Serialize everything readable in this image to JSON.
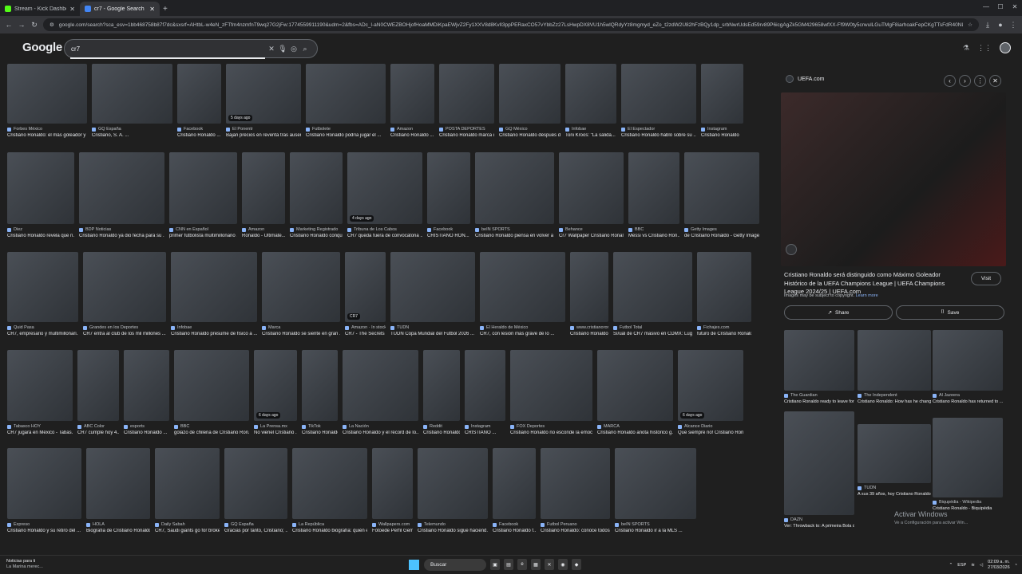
{
  "tabs": [
    {
      "label": "Stream - Kick Dashboard",
      "color": "#53fc18"
    },
    {
      "label": "cr7 - Google Search",
      "color": "#4285f4"
    }
  ],
  "address": {
    "url": "google.com/search?sca_esv=1bb468758b87f7dc&sxsrf=AHtbL-w4eN_zFTfm4nzmfnT9wq27G2jFw:1774559911190&udm=2&fbs=ADc_l-aN0CWEZBOHjofHoaMMDiKpaEWjvZ2Fy1XXV8d8KvlI3ppPERaxCO57vYbbZz27LsHwpDX8VU1h5wlQRdyYz8mgmyd_eZo_t2zdW2U82hFzBQy1dp_srbNwrUdsEd59rv89P6icgAgZk5GM429658wfXX-Ff9W0ty5crwulLGuTMgF8iarhoakFepCKgTTsFdR40NLC8tZ5_LeBVTLbfG80A8cq=cr7&sa=X&ved=2ahUKEwjRrCiGN0L-TAxXpmWoFHXWAGvIQtKgLegQIGBAB&biw=34..."
  },
  "search": {
    "logo": "Google",
    "query": "cr7"
  },
  "row1": [
    {
      "src": "Forbes México",
      "cap": "Cristiano Ronaldo: el más goleador y ..."
    },
    {
      "src": "GQ España",
      "cap": "Cristiano, S. A. ..."
    },
    {
      "src": "Facebook",
      "cap": "Cristiano Ronaldo ..."
    },
    {
      "src": "El Ponentr",
      "cap": "Bajan precios en reventa tras ausenc...",
      "badge": "5 days ago"
    },
    {
      "src": "Futbolete",
      "cap": "Cristiano Ronaldo podría jugar el ..."
    },
    {
      "src": "Amazon",
      "cap": "Cristiano Ronaldo ..."
    },
    {
      "src": "POSTA DEPORTES",
      "cap": "Cristiano Ronaldo marca d..."
    },
    {
      "src": "GQ México",
      "cap": "Cristiano Ronaldo después de Qatar 2..."
    },
    {
      "src": "Infobae",
      "cap": "Toni Kroos: \"La salida..."
    },
    {
      "src": "El Espectador",
      "cap": "Cristiano Ronaldo habló sobre su ..."
    },
    {
      "src": "Instagram",
      "cap": "Cristiano Ronaldo"
    }
  ],
  "row2": [
    {
      "src": "Diez",
      "cap": "Cristiano Ronaldo revela que n..."
    },
    {
      "src": "BDP Noticias",
      "cap": "Cristiano Ronaldo ya dio fecha para su ..."
    },
    {
      "src": "CNN en Español",
      "cap": "primer futbolista multimillonario ..."
    },
    {
      "src": "Amazon",
      "cap": "Ronaldo - Ultimate..."
    },
    {
      "src": "Marketing Registrado",
      "cap": "Cristiano Ronaldo conquista ..."
    },
    {
      "src": "Tribuna de Los Cabos",
      "cap": "CR7 queda fuera de convocatoria ...",
      "badge": "4 days ago"
    },
    {
      "src": "Facebook",
      "cap": "CRISTIANO RON..."
    },
    {
      "src": "beIN SPORTS",
      "cap": "Cristiano Ronaldo piensa en volver a ..."
    },
    {
      "src": "Behance",
      "cap": "Cr7 Wallpaper Cristiano Ronal..."
    },
    {
      "src": "BBC",
      "cap": "Messi vs Cristiano Ron..."
    },
    {
      "src": "Getty Images",
      "cap": "de Cristiano Ronaldo - Getty Image..."
    }
  ],
  "row3": [
    {
      "src": "Quid Pasa",
      "cap": "CR7, empresario y multimillonari..."
    },
    {
      "src": "Grandes en los Deportes",
      "cap": "CR7 entra al club de los mil millones ..."
    },
    {
      "src": "Infobae",
      "cap": "Cristiano Ronaldo presume de físico a ..."
    },
    {
      "src": "Marca",
      "cap": "Cristiano Ronaldo se siente en gran ..."
    },
    {
      "src": "Amazon · In stock",
      "cap": "CR7 - The Secrets ...",
      "badge": "CR7"
    },
    {
      "src": "TUDN",
      "cap": "TUDN Copa Mundial del Futbol 2026 ..."
    },
    {
      "src": "El Heraldo de México",
      "cap": "CR7, con lesión más grave de lo ..."
    },
    {
      "src": "www.cristianoronal...",
      "cap": "Cristiano Ronaldo |..."
    },
    {
      "src": "Futbol Total",
      "cap": "Sí/uál de CR7 masivo en CDMX: Lug..."
    },
    {
      "src": "Fichajes.com",
      "cap": "futuro de Cristiano Ronaldo"
    }
  ],
  "row4": [
    {
      "src": "Tabasco HOY",
      "cap": "CR7 jugará en México - Tabas..."
    },
    {
      "src": "ABC Color",
      "cap": "CR7 cumple hoy 4..."
    },
    {
      "src": "esports",
      "cap": "Cristiano Ronaldo ..."
    },
    {
      "src": "BBC",
      "cap": "golazo de chilena de Cristiano Ron..."
    },
    {
      "src": "La Prensa.mx",
      "cap": "No vienel Cristiano ...",
      "badge": "6 days ago"
    },
    {
      "src": "TikTok",
      "cap": "Cristiano Ronaldo: ..."
    },
    {
      "src": "La Nación",
      "cap": "Cristiano Ronaldo y el récord de lo..."
    },
    {
      "src": "Reddit",
      "cap": "Cristiano Ronaldo ..."
    },
    {
      "src": "Instagram",
      "cap": "CRISTIANO ..."
    },
    {
      "src": "FOX Deportes",
      "cap": "Cristiano Ronaldo no esconde la emoci..."
    },
    {
      "src": "MARCA",
      "cap": "Cristiano Ronaldo anota histórico g..."
    },
    {
      "src": "Alcance Diario",
      "cap": "Que siempre no! Cristiano Ron...",
      "badge": "6 days ago"
    }
  ],
  "row5": [
    {
      "src": "Expreso",
      "cap": "Cristiano Ronaldo y su retiro del ..."
    },
    {
      "src": "HOLA",
      "cap": "Biografía de Cristiano Ronaldo"
    },
    {
      "src": "Daily Sabah",
      "cap": "CR7, Saudi giants go for broke..."
    },
    {
      "src": "GQ España",
      "cap": "Gracias por tanto, Cristiano; ..."
    },
    {
      "src": "La República",
      "cap": "Cristiano Ronaldo biografía: quién e..."
    },
    {
      "src": "Wallpapers.com",
      "cap": "Fotoede Perfil Gem..."
    },
    {
      "src": "Telemundo",
      "cap": "Cristiano Ronaldo sigue haciend..."
    },
    {
      "src": "Facebook",
      "cap": "Cristiano Ronaldo f..."
    },
    {
      "src": "Futbol Peruano",
      "cap": "Cristiano Ronaldo: conoce todos l..."
    },
    {
      "src": "beIN SPORTS",
      "cap": "Cristiano Ronaldo ir a la MLS ..."
    }
  ],
  "panel": {
    "site": "UEFA.com",
    "title": "Cristiano Ronaldo será distinguido como Máximo Goleador Histórico de la UEFA Champions League | UEFA Champions League 2024/25 | UEFA.com",
    "visit": "Visit",
    "copyright": "Images may be subject to copyright.",
    "learn": "Learn more",
    "share": "Share",
    "save": "Save"
  },
  "related": [
    {
      "src": "The Guardian",
      "cap": "Cristiano Ronaldo ready to leave for Re..."
    },
    {
      "src": "The Independent",
      "cap": "Cristiano Ronaldo: How has he change..."
    },
    {
      "src": "Al Jazeera",
      "cap": "Cristiano Ronaldo has returned to ..."
    },
    {
      "src": "DAZN",
      "cap": "Ver: Throwback to: A primeira Bola de..."
    },
    {
      "src": "TUDN",
      "cap": "A sus 39 años, hoy Cristiano Ronaldo..."
    },
    {
      "src": "Biqupédia - Wikipedia",
      "cap": "Cristiano Ronaldo - Biquipédia"
    }
  ],
  "activate": {
    "title": "Activar Windows",
    "sub": "Ve a Configuración para activar Win..."
  },
  "taskbar": {
    "news1": "Noticias para ti",
    "news2": "La Marina merec...",
    "search": "Buscar",
    "lang": "ESP",
    "time": "02:09 a. m.",
    "date": "27/03/2026"
  }
}
